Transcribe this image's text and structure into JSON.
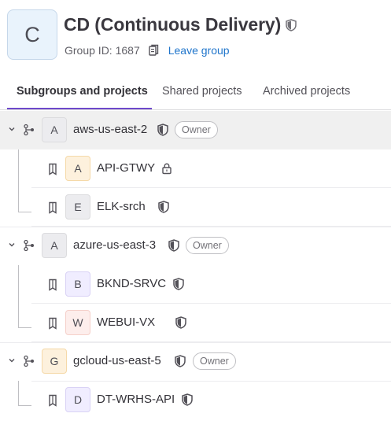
{
  "group": {
    "avatar_letter": "C",
    "title": "CD (Continuous Delivery)",
    "group_id": "Group ID: 1687",
    "leave_label": "Leave group"
  },
  "tabs": [
    {
      "label": "Subgroups and projects",
      "active": true
    },
    {
      "label": "Shared projects",
      "active": false
    },
    {
      "label": "Archived projects",
      "active": false
    }
  ],
  "items": [
    {
      "kind": "group",
      "letter": "A",
      "name": "aws-us-east-2",
      "badge": "Owner"
    },
    {
      "kind": "project",
      "letter": "A",
      "name": "API-GTWY",
      "visibility": "private"
    },
    {
      "kind": "project",
      "letter": "E",
      "name": "ELK-srch",
      "visibility": "internal"
    },
    {
      "kind": "group",
      "letter": "A",
      "name": "azure-us-east-3",
      "badge": "Owner"
    },
    {
      "kind": "project",
      "letter": "B",
      "name": "BKND-SRVC",
      "visibility": "internal"
    },
    {
      "kind": "project",
      "letter": "W",
      "name": "WEBUI-VX",
      "visibility": "internal"
    },
    {
      "kind": "group",
      "letter": "G",
      "name": "gcloud-us-east-5",
      "badge": "Owner"
    },
    {
      "kind": "project",
      "letter": "D",
      "name": "DT-WRHS-API",
      "visibility": "internal"
    }
  ],
  "colors": {
    "accent": "#6e49cb",
    "link": "#1f75cb",
    "row_highlight": "#f0f0f0"
  },
  "icons": {
    "title_visibility": "shield-icon",
    "copy": "copy-icon",
    "expand": "chevron-down-icon",
    "subgroup": "subgroup-icon",
    "project": "bookmark-icon",
    "private": "lock-icon",
    "internal": "shield-icon"
  }
}
